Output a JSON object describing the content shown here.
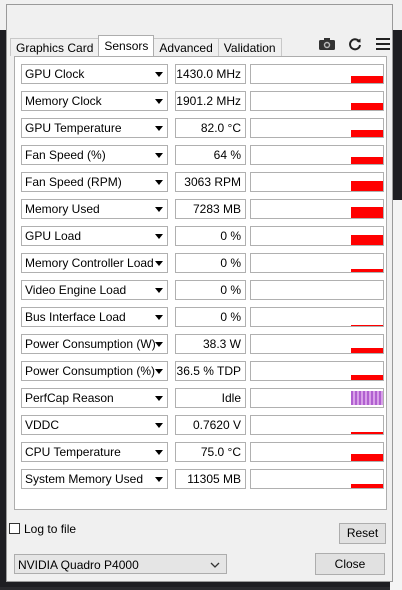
{
  "tabs": [
    "Graphics Card",
    "Sensors",
    "Advanced",
    "Validation"
  ],
  "active_tab": 1,
  "toolbar": {
    "camera_icon": "camera-icon",
    "refresh_icon": "refresh-icon",
    "menu_icon": "hamburger-menu-icon"
  },
  "sensors": [
    {
      "name": "GPU Clock",
      "value": "1430.0 MHz",
      "level": 0.55
    },
    {
      "name": "Memory Clock",
      "value": "1901.2 MHz",
      "level": 0.6
    },
    {
      "name": "GPU Temperature",
      "value": "82.0 °C",
      "level": 0.6
    },
    {
      "name": "Fan Speed (%)",
      "value": "64 %",
      "level": 0.6
    },
    {
      "name": "Fan Speed (RPM)",
      "value": "3063 RPM",
      "level": 0.8
    },
    {
      "name": "Memory Used",
      "value": "7283 MB",
      "level": 0.9
    },
    {
      "name": "GPU Load",
      "value": "0 %",
      "level": 0.8
    },
    {
      "name": "Memory Controller Load",
      "value": "0 %",
      "level": 0.25
    },
    {
      "name": "Video Engine Load",
      "value": "0 %",
      "level": 0
    },
    {
      "name": "Bus Interface Load",
      "value": "0 %",
      "level": 0.05
    },
    {
      "name": "Power Consumption (W)",
      "value": "38.3 W",
      "level": 0.4
    },
    {
      "name": "Power Consumption (%)",
      "value": "36.5 % TDP",
      "level": 0.4
    },
    {
      "name": "PerfCap Reason",
      "value": "Idle",
      "level": 1.0
    },
    {
      "name": "VDDC",
      "value": "0.7620 V",
      "level": 0.15
    },
    {
      "name": "CPU Temperature",
      "value": "75.0 °C",
      "level": 0.6
    },
    {
      "name": "System Memory Used",
      "value": "11305 MB",
      "level": 0.3
    }
  ],
  "log_to_file_label": "Log to file",
  "reset_label": "Reset",
  "gpu_select": "NVIDIA Quadro P4000",
  "close_label": "Close",
  "colors": {
    "graph": "#ff0000",
    "perfcap": "#b060d0"
  }
}
